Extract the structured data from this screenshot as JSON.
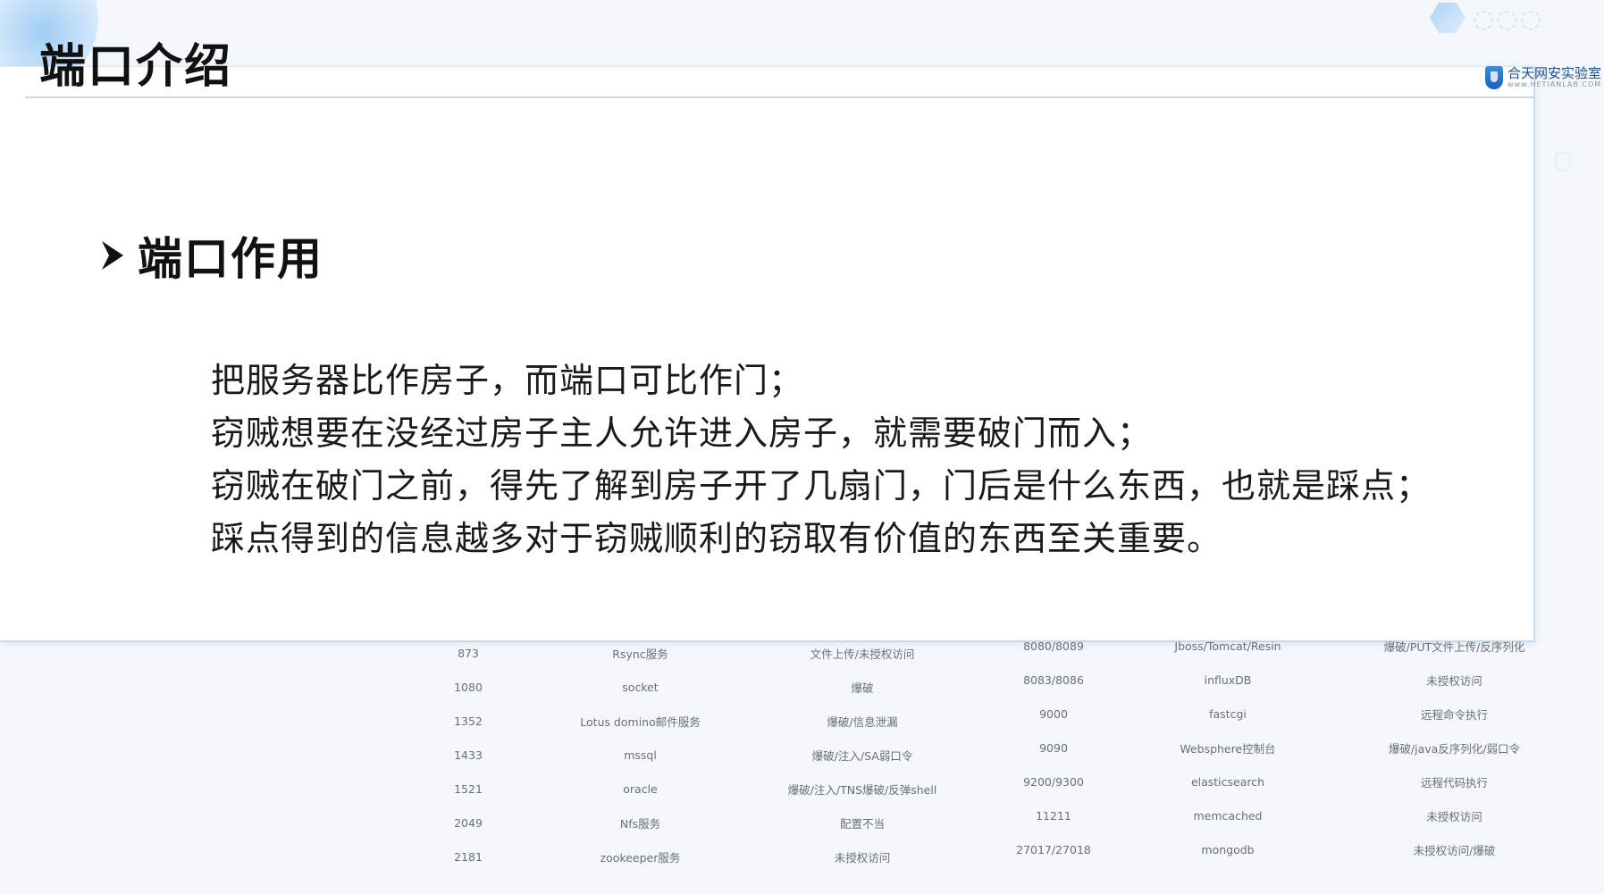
{
  "header": {
    "title": "端口介绍",
    "watermark_logo": {
      "name": "合天网安实验室",
      "url": "www.HETIANLAB.COM"
    }
  },
  "section": {
    "heading": "端口作用",
    "paragraphs": [
      "把服务器比作房子，而端口可比作门；",
      "窃贼想要在没经过房子主人允许进入房子，就需要破门而入；",
      "窃贼在破门之前，得先了解到房子开了几扇门，门后是什么东西，也就是踩点；踩点得到的信息越多对于窃贼顺利的窃取有价值的东西至关重要。"
    ]
  },
  "port_table": {
    "rows": [
      [
        "873",
        "Rsync服务",
        "文件上传/未授权访问",
        "8080/8089",
        "Jboss/Tomcat/Resin",
        "爆破/PUT文件上传/反序列化"
      ],
      [
        "1080",
        "socket",
        "爆破",
        "8083/8086",
        "influxDB",
        "未授权访问"
      ],
      [
        "1352",
        "Lotus domino邮件服务",
        "爆破/信息泄漏",
        "9000",
        "fastcgi",
        "远程命令执行"
      ],
      [
        "1433",
        "mssql",
        "爆破/注入/SA弱口令",
        "9090",
        "Websphere控制台",
        "爆破/java反序列化/弱口令"
      ],
      [
        "1521",
        "oracle",
        "爆破/注入/TNS爆破/反弹shell",
        "9200/9300",
        "elasticsearch",
        "远程代码执行"
      ],
      [
        "2049",
        "Nfs服务",
        "配置不当",
        "11211",
        "memcached",
        "未授权访问"
      ],
      [
        "2181",
        "zookeeper服务",
        "未授权访问",
        "27017/27018",
        "mongodb",
        "未授权访问/爆破"
      ]
    ]
  }
}
